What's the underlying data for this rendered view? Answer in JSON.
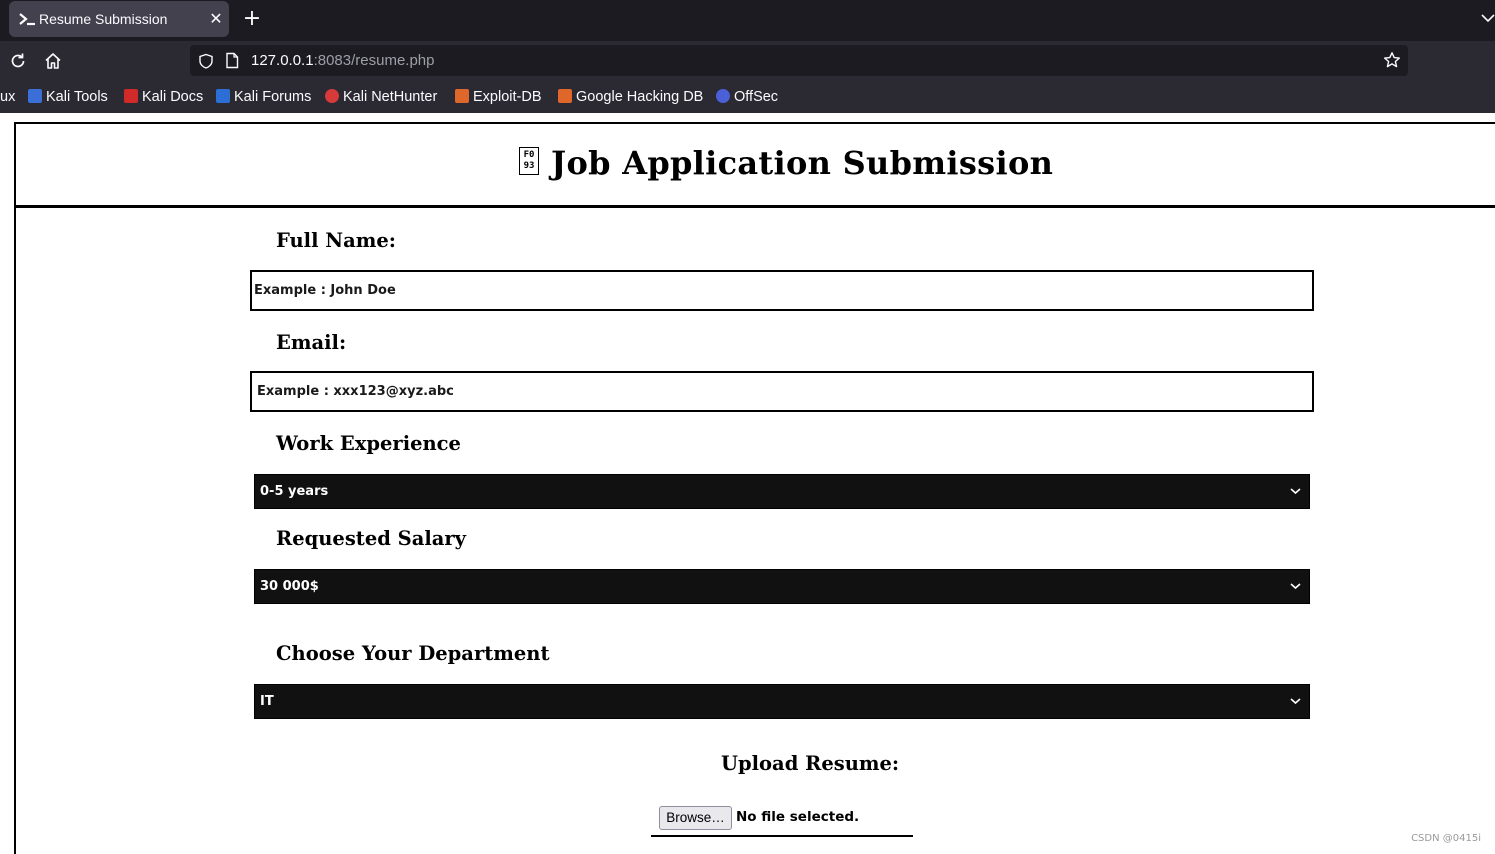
{
  "browser": {
    "tab": {
      "title": "Resume Submission",
      "close_symbol": "✕"
    },
    "new_tab_symbol": "+",
    "url": {
      "host": "127.0.0.1",
      "rest": ":8083/resume.php"
    },
    "bookmarks": [
      {
        "label": "ux",
        "icon": "kali-linux-icon"
      },
      {
        "label": "Kali Tools",
        "icon": "kali-tools-icon"
      },
      {
        "label": "Kali Docs",
        "icon": "kali-docs-icon"
      },
      {
        "label": "Kali Forums",
        "icon": "kali-forums-icon"
      },
      {
        "label": "Kali NetHunter",
        "icon": "kali-nethunter-icon"
      },
      {
        "label": "Exploit-DB",
        "icon": "exploit-db-icon"
      },
      {
        "label": "Google Hacking DB",
        "icon": "ghdb-icon"
      },
      {
        "label": "OffSec",
        "icon": "offsec-icon"
      }
    ]
  },
  "page": {
    "header": {
      "icon_glyph": "F0\n93",
      "title": "Job Application Submission"
    },
    "form": {
      "full_name": {
        "label": "Full Name:",
        "placeholder": "Example : John Doe"
      },
      "email": {
        "label": "Email:",
        "placeholder": "Example : xxx123@xyz.abc"
      },
      "experience": {
        "label": "Work Experience",
        "value": "0-5 years"
      },
      "salary": {
        "label": "Requested Salary",
        "value": "30 000$"
      },
      "department": {
        "label": "Choose Your Department",
        "value": "IT"
      },
      "upload": {
        "label": "Upload Resume:",
        "button": "Browse…",
        "status": "No file selected."
      }
    }
  },
  "watermark": "CSDN @0415i",
  "colors": {
    "tab_bg": "#42414d",
    "chrome_bg": "#2b2a33",
    "tabbar_bg": "#1c1b22",
    "select_bg": "#111111"
  }
}
